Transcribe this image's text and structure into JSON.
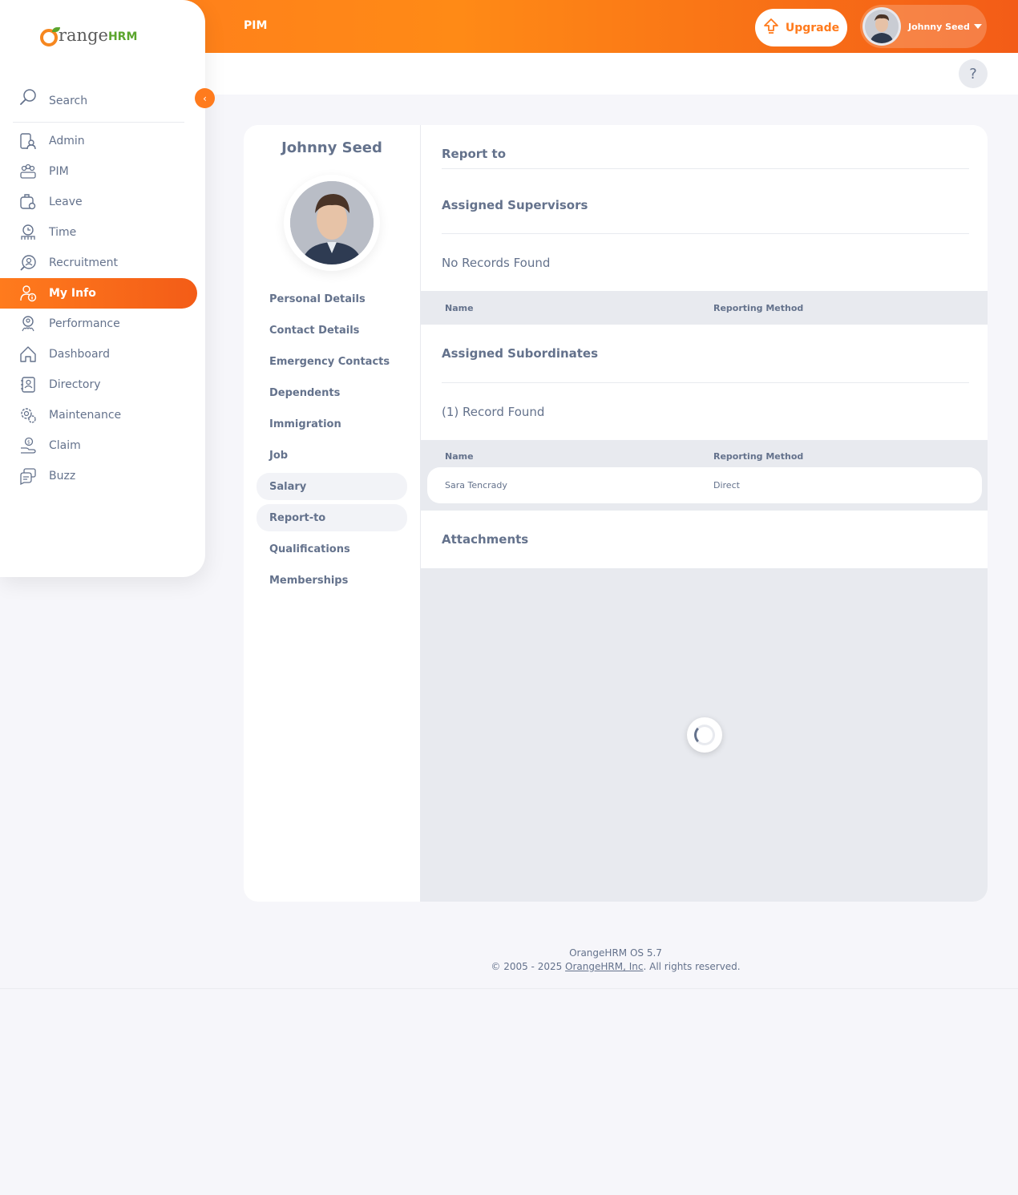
{
  "header": {
    "module": "PIM",
    "upgrade_label": "Upgrade",
    "user_name": "Johnny Seed",
    "accent": "#ff7b1d"
  },
  "help": {
    "label": "?"
  },
  "sidebar": {
    "brand_range": "range",
    "brand_hrm": "HRM",
    "search_label": "Search",
    "collapse_label": "‹",
    "items": [
      {
        "label": "Admin",
        "icon": "admin-icon"
      },
      {
        "label": "PIM",
        "icon": "pim-icon"
      },
      {
        "label": "Leave",
        "icon": "leave-icon"
      },
      {
        "label": "Time",
        "icon": "time-icon"
      },
      {
        "label": "Recruitment",
        "icon": "recruitment-icon"
      },
      {
        "label": "My Info",
        "icon": "my-info-icon",
        "active": true
      },
      {
        "label": "Performance",
        "icon": "performance-icon"
      },
      {
        "label": "Dashboard",
        "icon": "dashboard-icon"
      },
      {
        "label": "Directory",
        "icon": "directory-icon"
      },
      {
        "label": "Maintenance",
        "icon": "maintenance-icon"
      },
      {
        "label": "Claim",
        "icon": "claim-icon"
      },
      {
        "label": "Buzz",
        "icon": "buzz-icon"
      }
    ]
  },
  "employee": {
    "name": "Johnny Seed",
    "tabs": [
      "Personal Details",
      "Contact Details",
      "Emergency Contacts",
      "Dependents",
      "Immigration",
      "Job",
      "Salary",
      "Report-to",
      "Qualifications",
      "Memberships"
    ]
  },
  "report_to": {
    "title": "Report to",
    "supervisors": {
      "title": "Assigned Supervisors",
      "count": "No Records Found",
      "columns": [
        "Name",
        "Reporting Method"
      ],
      "rows": []
    },
    "subordinates": {
      "title": "Assigned Subordinates",
      "count": "(1) Record Found",
      "columns": [
        "Name",
        "Reporting Method"
      ],
      "rows": [
        {
          "name": "Sara Tencrady",
          "method": "Direct"
        }
      ]
    },
    "attachments": {
      "title": "Attachments"
    }
  },
  "footer": {
    "version": "OrangeHRM OS 5.7",
    "copyright_prefix": "© 2005 - 2025 ",
    "company_link": "OrangeHRM, Inc",
    "copyright_suffix": ". All rights reserved."
  }
}
